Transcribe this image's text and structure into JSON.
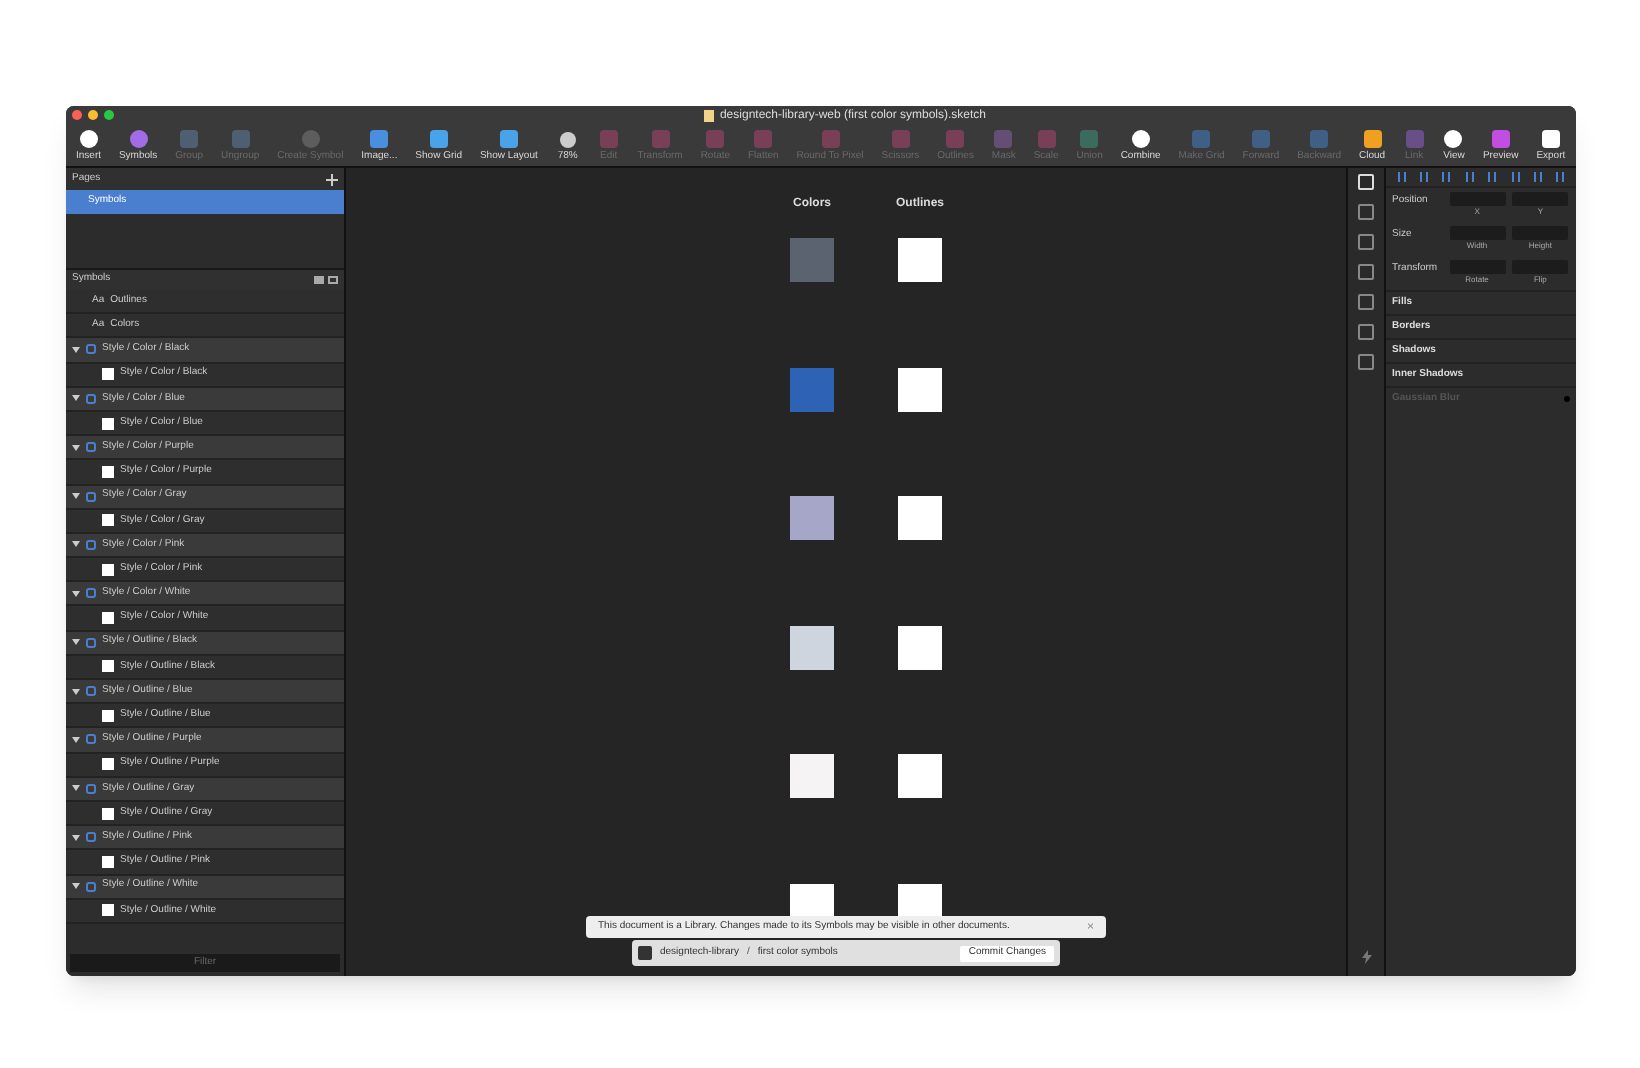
{
  "window": {
    "title": "designtech-library-web (first color symbols).sketch"
  },
  "toolbar": [
    {
      "label": "Insert",
      "disabled": false
    },
    {
      "label": "Symbols",
      "disabled": false
    },
    {
      "label": "Group",
      "disabled": true
    },
    {
      "label": "Ungroup",
      "disabled": true
    },
    {
      "label": "Create Symbol",
      "disabled": true
    },
    {
      "label": "Image...",
      "disabled": false
    },
    {
      "label": "Show Grid",
      "disabled": false
    },
    {
      "label": "Show Layout",
      "disabled": false
    },
    {
      "label": "78%",
      "disabled": false,
      "kind": "zoom"
    },
    {
      "label": "Edit",
      "disabled": true
    },
    {
      "label": "Transform",
      "disabled": true
    },
    {
      "label": "Rotate",
      "disabled": true
    },
    {
      "label": "Flatten",
      "disabled": true
    },
    {
      "label": "Round To Pixel",
      "disabled": true
    },
    {
      "label": "Scissors",
      "disabled": true
    },
    {
      "label": "Outlines",
      "disabled": true
    },
    {
      "label": "Mask",
      "disabled": true
    },
    {
      "label": "Scale",
      "disabled": true
    },
    {
      "label": "Union",
      "disabled": true
    },
    {
      "label": "Combine",
      "disabled": false
    },
    {
      "label": "Make Grid",
      "disabled": true
    },
    {
      "label": "Forward",
      "disabled": true
    },
    {
      "label": "Backward",
      "disabled": true
    },
    {
      "label": "Cloud",
      "disabled": false
    },
    {
      "label": "Link",
      "disabled": true
    },
    {
      "label": "View",
      "disabled": false
    },
    {
      "label": "Preview",
      "disabled": false
    },
    {
      "label": "Export",
      "disabled": false
    }
  ],
  "pages": {
    "title": "Pages",
    "items": [
      {
        "label": "Symbols",
        "selected": true
      }
    ]
  },
  "layers": {
    "title": "Symbols",
    "items": [
      {
        "label": "Outlines",
        "kind": "text-style",
        "prefix": "Aa"
      },
      {
        "label": "Colors",
        "kind": "text-style",
        "prefix": "Aa"
      },
      {
        "label": "Style / Color / Black",
        "kind": "symbol",
        "expanded": true,
        "children": [
          {
            "label": "Style / Color / Black"
          }
        ]
      },
      {
        "label": "Style / Color / Blue",
        "kind": "symbol",
        "expanded": true,
        "children": [
          {
            "label": "Style / Color / Blue"
          }
        ]
      },
      {
        "label": "Style / Color / Purple",
        "kind": "symbol",
        "expanded": true,
        "children": [
          {
            "label": "Style / Color / Purple"
          }
        ]
      },
      {
        "label": "Style / Color / Gray",
        "kind": "symbol",
        "expanded": true,
        "children": [
          {
            "label": "Style / Color / Gray"
          }
        ]
      },
      {
        "label": "Style / Color / Pink",
        "kind": "symbol",
        "expanded": true,
        "children": [
          {
            "label": "Style / Color / Pink"
          }
        ]
      },
      {
        "label": "Style / Color / White",
        "kind": "symbol",
        "expanded": true,
        "children": [
          {
            "label": "Style / Color / White"
          }
        ]
      },
      {
        "label": "Style / Outline / Black",
        "kind": "symbol",
        "expanded": true,
        "children": [
          {
            "label": "Style / Outline / Black"
          }
        ]
      },
      {
        "label": "Style / Outline / Blue",
        "kind": "symbol",
        "expanded": true,
        "children": [
          {
            "label": "Style / Outline / Blue"
          }
        ]
      },
      {
        "label": "Style / Outline / Purple",
        "kind": "symbol",
        "expanded": true,
        "children": [
          {
            "label": "Style / Outline / Purple"
          }
        ]
      },
      {
        "label": "Style / Outline / Gray",
        "kind": "symbol",
        "expanded": true,
        "children": [
          {
            "label": "Style / Outline / Gray"
          }
        ]
      },
      {
        "label": "Style / Outline / Pink",
        "kind": "symbol",
        "expanded": true,
        "children": [
          {
            "label": "Style / Outline / Pink"
          }
        ]
      },
      {
        "label": "Style / Outline / White",
        "kind": "symbol",
        "expanded": true,
        "children": [
          {
            "label": "Style / Outline / White"
          }
        ]
      }
    ],
    "filter_placeholder": "Filter"
  },
  "canvas": {
    "columns": [
      "Colors",
      "Outlines"
    ],
    "swatches": [
      {
        "color": "#5b6270"
      },
      {
        "color": "#2d62b5"
      },
      {
        "color": "#a6a6c8"
      },
      {
        "color": "#cfd5de"
      },
      {
        "color": "#f5f3f3"
      },
      {
        "color": "#ffffff"
      }
    ]
  },
  "notice": {
    "text": "This document is a Library. Changes made to its Symbols may be visible in other documents.",
    "close": "×"
  },
  "branch": {
    "repo": "designtech-library",
    "separator": "/",
    "branch": "first color symbols",
    "button": "Commit Changes"
  },
  "inspector": {
    "rows": [
      {
        "label": "Position",
        "fields": [
          "X",
          "Y"
        ]
      },
      {
        "label": "Size",
        "fields": [
          "Width",
          "Height"
        ]
      },
      {
        "label": "Transform",
        "fields": [
          "Rotate",
          "Flip"
        ]
      }
    ],
    "sections": [
      {
        "label": "Fills",
        "disabled": false
      },
      {
        "label": "Borders",
        "disabled": false
      },
      {
        "label": "Shadows",
        "disabled": false
      },
      {
        "label": "Inner Shadows",
        "disabled": false
      },
      {
        "label": "Gaussian Blur",
        "disabled": true
      }
    ]
  }
}
